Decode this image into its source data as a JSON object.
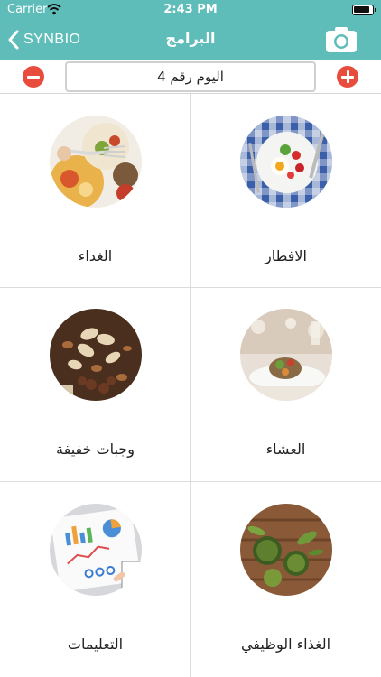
{
  "status_bar": {
    "carrier": "Carrier",
    "time": "2:43 PM"
  },
  "nav": {
    "back_label": "SYNBIO",
    "title": "البرامج"
  },
  "day_selector": {
    "day_label": "اليوم رقم 4"
  },
  "colors": {
    "header_bg": "#5fbdb9",
    "action_red": "#e84c3d"
  },
  "grid_items": [
    {
      "label": "الافطار",
      "icon": "breakfast-photo"
    },
    {
      "label": "الغداء",
      "icon": "lunch-photo"
    },
    {
      "label": "العشاء",
      "icon": "dinner-photo"
    },
    {
      "label": "وجبات خفيفة",
      "icon": "snacks-photo"
    },
    {
      "label": "الغذاء الوظيفي",
      "icon": "functional-food-photo"
    },
    {
      "label": "التعليمات",
      "icon": "instructions-photo"
    }
  ]
}
